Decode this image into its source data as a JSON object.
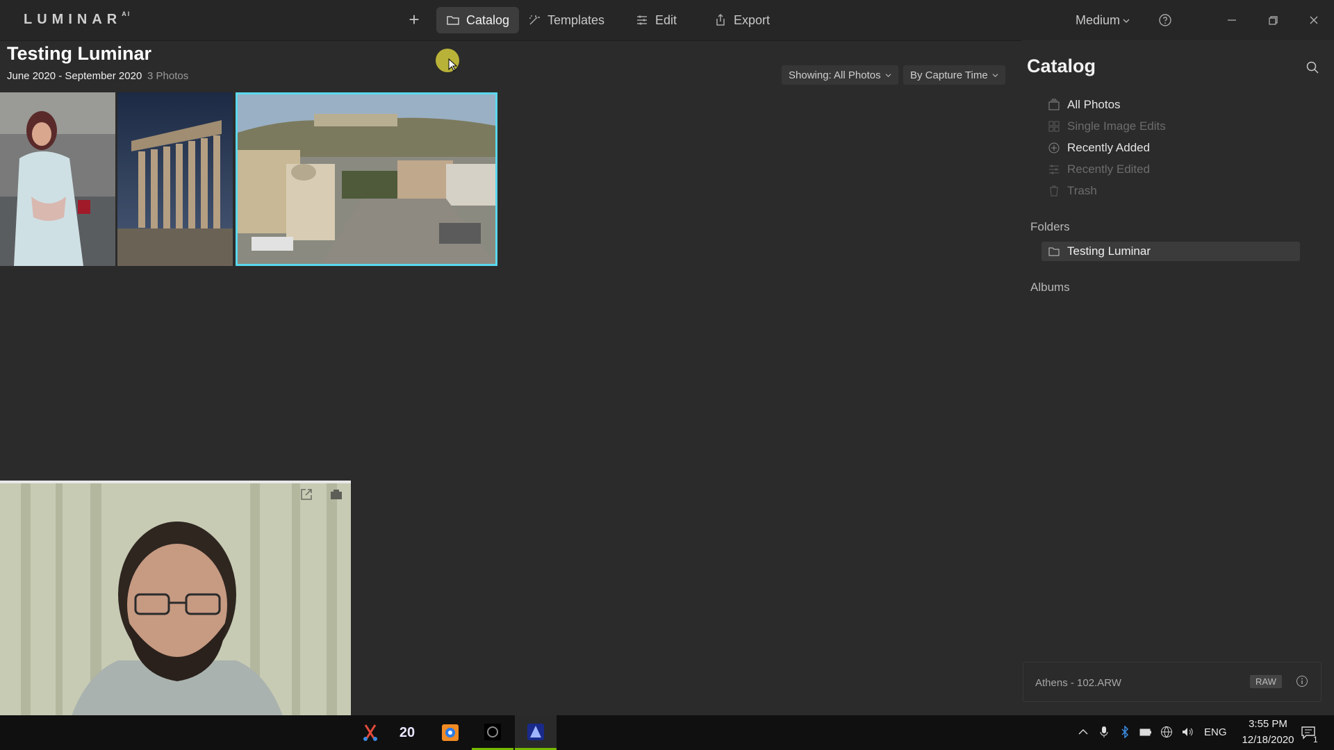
{
  "app": {
    "logo_text": "LUMINAR",
    "logo_sup": "AI"
  },
  "nav": {
    "add_label": "+",
    "tabs": [
      {
        "label": "Catalog",
        "icon": "folder-icon",
        "active": true
      },
      {
        "label": "Templates",
        "icon": "sparkle-icon",
        "active": false
      },
      {
        "label": "Edit",
        "icon": "sliders-icon",
        "active": false
      },
      {
        "label": "Export",
        "icon": "share-icon",
        "active": false
      }
    ],
    "zoom": "Medium"
  },
  "header": {
    "title": "Testing Luminar",
    "date_range": "June 2020 - September 2020",
    "count": "3 Photos",
    "filter_show": "Showing: All Photos",
    "filter_sort": "By Capture Time"
  },
  "photos": [
    {
      "subject": "woman in light dress"
    },
    {
      "subject": "ancient temple columns"
    },
    {
      "subject": "Athens city square",
      "selected": true
    }
  ],
  "panel": {
    "title": "Catalog",
    "items": [
      {
        "label": "All Photos",
        "enabled": true
      },
      {
        "label": "Single Image Edits",
        "enabled": false
      },
      {
        "label": "Recently Added",
        "enabled": true
      },
      {
        "label": "Recently Edited",
        "enabled": false
      },
      {
        "label": "Trash",
        "enabled": false
      }
    ],
    "folders_label": "Folders",
    "folders": [
      {
        "label": "Testing Luminar"
      }
    ],
    "albums_label": "Albums"
  },
  "info": {
    "filename": "Athens - 102.ARW",
    "badge": "RAW"
  },
  "taskbar": {
    "lang": "ENG",
    "time": "3:55 PM",
    "date": "12/18/2020",
    "notif_count": "1",
    "app_badge": "20"
  },
  "colors": {
    "accent": "#5ad8ee",
    "selection": "#3d3d3d",
    "background": "#2b2b2b"
  }
}
